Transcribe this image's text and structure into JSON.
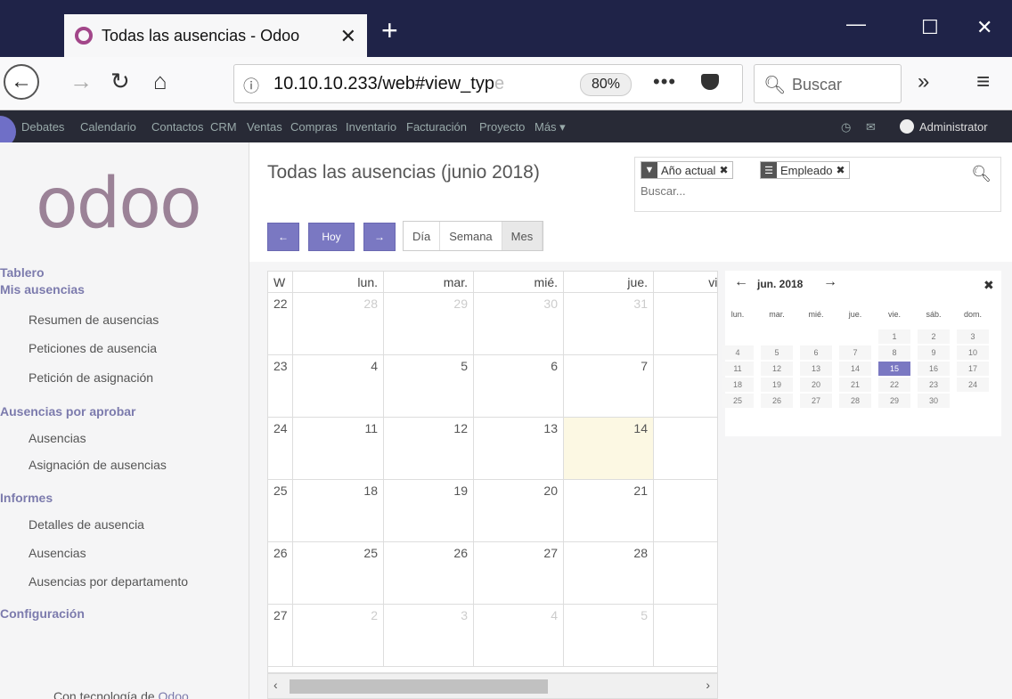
{
  "browser": {
    "tab_title": "Todas las ausencias - Odoo",
    "tab_close": "✕",
    "new_tab": "+",
    "url": "10.10.10.233/web#view_typ",
    "url_fade": "e",
    "zoom": "80%",
    "search_placeholder": "Buscar",
    "overflow": "»",
    "menu": "≡",
    "more": "•••"
  },
  "odoo_menu": {
    "items": [
      "Debates",
      "Calendario",
      "Contactos",
      "CRM",
      "Ventas",
      "Compras",
      "Inventario",
      "Facturación",
      "Proyecto",
      "Más ▾"
    ],
    "user": "Administrator"
  },
  "sidebar": {
    "logo": "odoo",
    "sections": [
      {
        "title": "Tablero",
        "links": []
      },
      {
        "title": "Mis ausencias",
        "links": [
          "Resumen de ausencias",
          "Peticiones de ausencia",
          "Petición de asignación"
        ]
      },
      {
        "title": "Ausencias por aprobar",
        "links": [
          "Ausencias",
          "Asignación de ausencias"
        ]
      },
      {
        "title": "Informes",
        "links": [
          "Detalles de ausencia",
          "Ausencias",
          "Ausencias por departamento"
        ]
      },
      {
        "title": "Configuración",
        "links": []
      }
    ],
    "powered_by": "Con tecnología de",
    "powered_brand": "Odoo"
  },
  "header": {
    "title": "Todas las ausencias (junio 2018)",
    "facets": [
      {
        "label": "Año actual",
        "icon": "filter-icon"
      },
      {
        "label": "Empleado",
        "icon": "groupby-icon"
      }
    ],
    "search_placeholder": "Buscar..."
  },
  "controls": {
    "prev": "←",
    "today": "Hoy",
    "next": "→",
    "views": [
      "Día",
      "Semana",
      "Mes"
    ],
    "active_view": "Mes"
  },
  "calendar": {
    "week_header": "W",
    "day_headers": [
      "lun.",
      "mar.",
      "mié.",
      "jue.",
      "vie."
    ],
    "weeks": [
      {
        "w": "22",
        "days": [
          "28",
          "29",
          "30",
          "31",
          ""
        ],
        "other": [
          true,
          true,
          true,
          true,
          false
        ]
      },
      {
        "w": "23",
        "days": [
          "4",
          "5",
          "6",
          "7",
          ""
        ],
        "other": [
          false,
          false,
          false,
          false,
          false
        ]
      },
      {
        "w": "24",
        "days": [
          "11",
          "12",
          "13",
          "14",
          ""
        ],
        "other": [
          false,
          false,
          false,
          false,
          false
        ]
      },
      {
        "w": "25",
        "days": [
          "18",
          "19",
          "20",
          "21",
          ""
        ],
        "other": [
          false,
          false,
          false,
          false,
          false
        ]
      },
      {
        "w": "26",
        "days": [
          "25",
          "26",
          "27",
          "28",
          ""
        ],
        "other": [
          false,
          false,
          false,
          false,
          false
        ]
      },
      {
        "w": "27",
        "days": [
          "2",
          "3",
          "4",
          "5",
          ""
        ],
        "other": [
          true,
          true,
          true,
          true,
          false
        ]
      }
    ],
    "today": "14",
    "today_color": "#fcf8e3"
  },
  "mini_calendar": {
    "title": "jun. 2018",
    "prev": "←",
    "next": "→",
    "close": "✖",
    "dow": [
      "lun.",
      "mar.",
      "mié.",
      "jue.",
      "vie.",
      "sáb.",
      "dom."
    ],
    "rows": [
      [
        "",
        "",
        "",
        "",
        "1",
        "2",
        "3"
      ],
      [
        "4",
        "5",
        "6",
        "7",
        "8",
        "9",
        "10"
      ],
      [
        "11",
        "12",
        "13",
        "14",
        "15",
        "16",
        "17"
      ],
      [
        "18",
        "19",
        "20",
        "21",
        "22",
        "23",
        "24"
      ],
      [
        "25",
        "26",
        "27",
        "28",
        "29",
        "30",
        ""
      ]
    ],
    "selected": "15",
    "accent": "#7a78c2"
  }
}
